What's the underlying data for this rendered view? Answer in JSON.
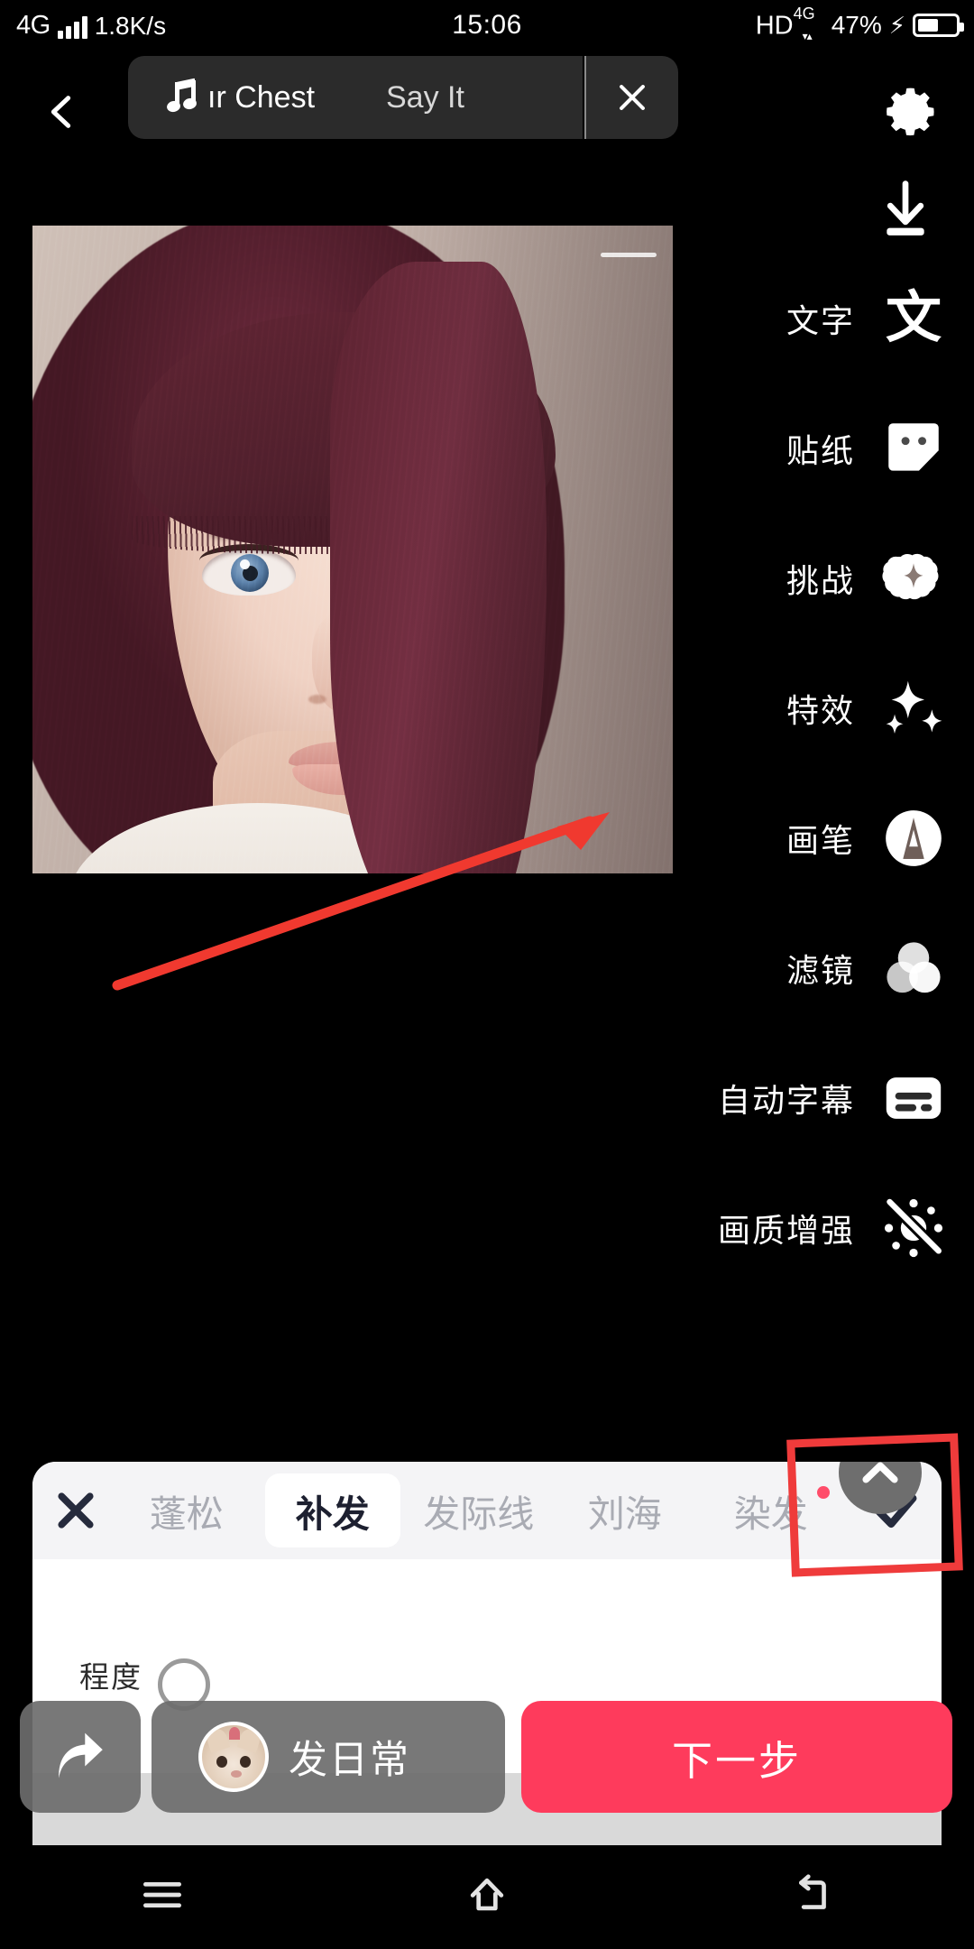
{
  "status_bar": {
    "network_type": "4G",
    "speed": "1.8K/s",
    "time": "15:06",
    "hd": "HD",
    "hd_sup": "4G",
    "battery_percent": "47%"
  },
  "top_bar": {
    "back_icon": "chevron-left-icon",
    "settings_icon": "gear-icon",
    "download_icon": "download-icon",
    "music": {
      "note_icon": "music-note-icon",
      "title": "ır Chest",
      "artist": "Say It",
      "close_icon": "close-icon"
    }
  },
  "tool_rail": [
    {
      "label": "文字",
      "icon": "text-icon"
    },
    {
      "label": "贴纸",
      "icon": "sticker-icon"
    },
    {
      "label": "挑战",
      "icon": "challenge-star-icon"
    },
    {
      "label": "特效",
      "icon": "sparkles-effects-icon"
    },
    {
      "label": "画笔",
      "icon": "brush-icon"
    },
    {
      "label": "滤镜",
      "icon": "filter-circles-icon"
    },
    {
      "label": "自动字幕",
      "icon": "auto-captions-icon"
    },
    {
      "label": "画质增强",
      "icon": "quality-enhance-off-icon"
    }
  ],
  "panel": {
    "close_icon": "close-icon",
    "confirm_icon": "check-icon",
    "collapse_icon": "chevron-up-icon",
    "tabs": [
      {
        "label": "蓬松",
        "active": false,
        "badge": false
      },
      {
        "label": "补发",
        "active": true,
        "badge": false
      },
      {
        "label": "发际线",
        "active": false,
        "badge": false
      },
      {
        "label": "刘海",
        "active": false,
        "badge": false
      },
      {
        "label": "染发",
        "active": false,
        "badge": true
      }
    ]
  },
  "slider": {
    "label": "程度",
    "knob_icon": "slider-knob-icon"
  },
  "bottom_actions": {
    "share_icon": "share-arrow-icon",
    "daily_label": "发日常",
    "daily_avatar": "cat-avatar",
    "next_label": "下一步"
  },
  "nav_bar": {
    "menu_icon": "menu-icon",
    "home_icon": "home-icon",
    "back_icon": "back-icon"
  },
  "annotations": {
    "arrow": "red-arrow-pointing-to-filter",
    "box": "red-highlight-box"
  },
  "colors": {
    "accent_red": "#fe3b5c",
    "annotation_red": "#ef3b3b",
    "badge_red": "#ff4d6a",
    "panel_bg": "#ffffff",
    "tab_strip_bg": "#f4f4f6",
    "active_tab_text": "#1d2030",
    "inactive_tab_text": "#a9abb3"
  }
}
